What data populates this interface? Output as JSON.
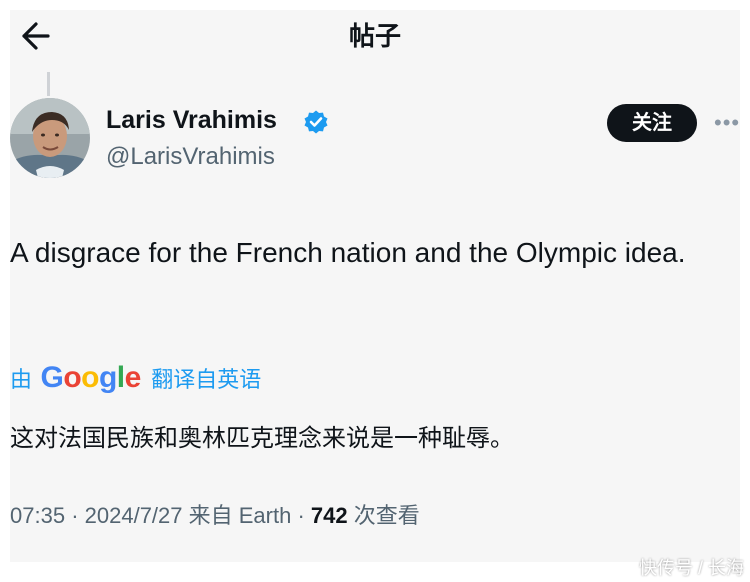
{
  "header": {
    "title": "帖子",
    "back_icon": "back-arrow-icon"
  },
  "author": {
    "name": "Laris Vrahimis",
    "handle": "@LarisVrahimis",
    "verified": true,
    "verified_color": "#1d9bf0",
    "follow_label": "关注",
    "more_icon": "more-options-icon"
  },
  "post": {
    "text": "A disgrace for the French nation and the Olympic idea."
  },
  "translation": {
    "prefix": "由",
    "provider": "Google",
    "suffix": "翻译自英语",
    "text": "这对法国民族和奥林匹克理念来说是一种耻辱。"
  },
  "meta": {
    "time": "07:35",
    "separator": "·",
    "date": "2024/7/27",
    "source": "来自 Earth",
    "views_count": "742",
    "views_label": "次查看"
  },
  "watermark": "快传号 / 长海",
  "colors": {
    "accent": "#1d9bf0",
    "text_primary": "#0f1419",
    "text_secondary": "#536471",
    "follow_bg": "#0f1419"
  }
}
